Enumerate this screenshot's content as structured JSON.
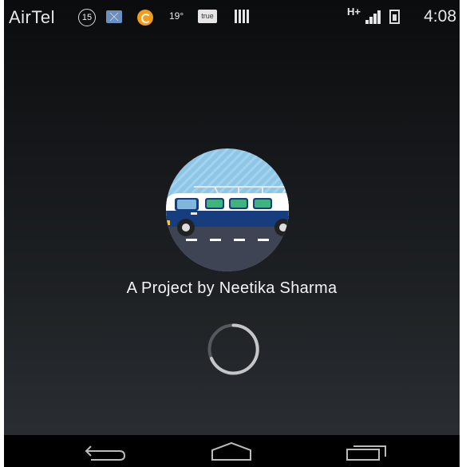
{
  "status_bar": {
    "carrier": "AirTel",
    "notification_count": "15",
    "weather": "19°",
    "app_badge": "true",
    "network_type": "H+",
    "time": "4:08",
    "icons": [
      "mail-icon",
      "orange-app-icon",
      "barcode-icon",
      "signal-icon",
      "battery-icon"
    ]
  },
  "splash": {
    "logo": "van-on-road-logo",
    "caption": "A Project by Neetika Sharma",
    "loading_indicator": "spinner"
  },
  "colors": {
    "sky": "#8ec6e6",
    "grass": "#2db14a",
    "road": "#3e4453",
    "van_body": "#173d7e",
    "text": "#f4f4f4"
  },
  "nav_bar": {
    "items": [
      "back-icon",
      "home-icon",
      "recent-apps-icon"
    ]
  }
}
